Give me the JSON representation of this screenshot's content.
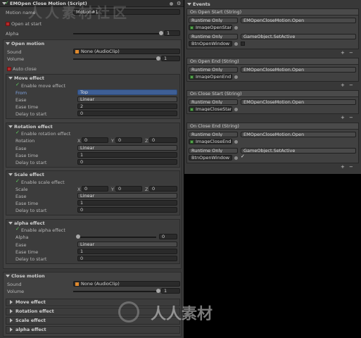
{
  "inspector": {
    "title": "EMOpen Close Motion (Script)",
    "motion_name_label": "Motion name",
    "motion_name_value": "Motion#1",
    "open_at_start": "Open at start",
    "alpha_label": "Alpha",
    "alpha_value": "1"
  },
  "open_motion": {
    "header": "Open motion",
    "sound_label": "Sound",
    "sound_value": "None (AudioClip)",
    "volume_label": "Volume",
    "volume_value": "1",
    "auto_close": "Auto close",
    "move": {
      "header": "Move effect",
      "enable": "Enable move effect",
      "from_label": "From",
      "from_value": "Top",
      "ease_label": "Ease",
      "ease_value": "Linear",
      "ease_time_label": "Ease time",
      "ease_time_value": "2",
      "delay_label": "Delay to start",
      "delay_value": "0"
    },
    "rotation": {
      "header": "Rotation effect",
      "enable": "Enable rotation effect",
      "rotation_label": "Rotation",
      "x_label": "X",
      "x_value": "0",
      "y_label": "Y",
      "y_value": "0",
      "z_label": "Z",
      "z_value": "0",
      "ease_label": "Ease",
      "ease_value": "Linear",
      "ease_time_label": "Ease time",
      "ease_time_value": "1",
      "delay_label": "Delay to start",
      "delay_value": "0"
    },
    "scale": {
      "header": "Scale effect",
      "enable": "Enable scale effect",
      "scale_label": "Scale",
      "x_label": "X",
      "x_value": "0",
      "y_label": "Y",
      "y_value": "0",
      "z_label": "Z",
      "z_value": "0",
      "ease_label": "Ease",
      "ease_value": "Linear",
      "ease_time_label": "Ease time",
      "ease_time_value": "1",
      "delay_label": "Delay to start",
      "delay_value": "0"
    },
    "alpha": {
      "header": "alpha effect",
      "enable": "Enable alpha effect",
      "alpha_label": "Alpha",
      "alpha_value": "0",
      "ease_label": "Ease",
      "ease_value": "Linear",
      "ease_time_label": "Ease time",
      "ease_time_value": "1",
      "delay_label": "Delay to start",
      "delay_value": "0"
    }
  },
  "close_motion": {
    "header": "Close motion",
    "sound_label": "Sound",
    "sound_value": "None (AudioClip)",
    "volume_label": "Volume",
    "volume_value": "1",
    "collapsed": [
      "Move effect",
      "Rotation effect",
      "Scale effect",
      "alpha effect"
    ]
  },
  "events": {
    "title": "Events",
    "groups": [
      {
        "header": "On Open Start (String)",
        "rows": [
          {
            "mode": "Runtime Only",
            "func": "EMOpenCloseMotion.Open",
            "obj": "ImageOpenStart"
          },
          {
            "mode": "Runtime Only",
            "func": "GameObject.SetActive",
            "obj": "BtnOpenWindow"
          }
        ]
      },
      {
        "header": "On Open End (String)",
        "rows": [
          {
            "mode": "Runtime Only",
            "func": "EMOpenCloseMotion.Open",
            "obj": "ImageOpenEnd"
          }
        ]
      },
      {
        "header": "On Close Start (String)",
        "rows": [
          {
            "mode": "Runtime Only",
            "func": "EMOpenCloseMotion.Open",
            "obj": "ImageCloseStart"
          }
        ]
      },
      {
        "header": "On Close End (String)",
        "rows": [
          {
            "mode": "Runtime Only",
            "func": "EMOpenCloseMotion.Open",
            "obj": "ImageCloseEnd"
          },
          {
            "mode": "Runtime Only",
            "func": "GameObject.SetActive",
            "obj": "BtnOpenWindow"
          }
        ]
      }
    ],
    "plus": "+",
    "minus": "−"
  },
  "watermark": {
    "top": "人人素材社区",
    "bottom": "人人素材"
  },
  "colors": {
    "panel": "#383838",
    "selected_dropdown": "#3e5f96",
    "checkmark": "#5fd25f",
    "red_toggle": "#b42a2a"
  }
}
